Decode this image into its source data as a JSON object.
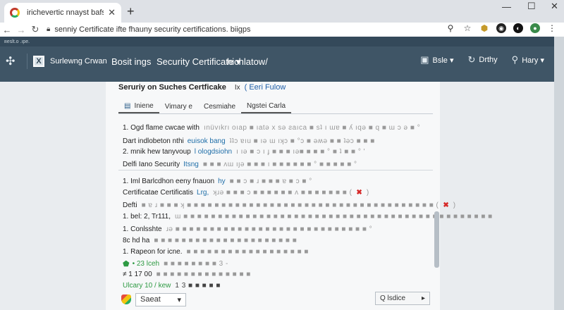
{
  "browser": {
    "tab_title": "irichevertic nnayst bafs",
    "url": "senniy Certificate ifte fhauny security certifications. biigps",
    "lock_icon": "lock-icon",
    "nav": {
      "back": "←",
      "forward": "→",
      "reload": "↻"
    },
    "window": {
      "min": "—",
      "max": "☐",
      "close": "✕"
    }
  },
  "app": {
    "top_strip": "ʀeslt.o .ıpe.",
    "brand_name": "Surlewng Crwan",
    "brand_box": "X",
    "nav": [
      "Bosit ings",
      "Security Certificate ▾",
      "hichlatow/"
    ],
    "header_buttons": [
      {
        "icon": "dashboard-icon",
        "glyph": "▣",
        "label": "Bsle ▾"
      },
      {
        "icon": "refresh-icon",
        "glyph": "↻",
        "label": "Drthy"
      },
      {
        "icon": "help-icon",
        "glyph": "⚲",
        "label": "Hary ▾"
      }
    ]
  },
  "page": {
    "title": "Seruriy on Suches Certficake",
    "title_x": "Ix",
    "title_link": "( Eeri Fulow",
    "tabs": [
      {
        "label": "Iniene",
        "icon": "document-icon"
      },
      {
        "label": "Vimary e"
      },
      {
        "label": "Cesmiahe"
      },
      {
        "label": "Ngstei Carla"
      }
    ],
    "rows": [
      {
        "text": "1.   Ogd flame cwcae with",
        "blur": "ınüvıkrı oıap ■ ıatǝ x sǝ ƨaıca ■ sʇ ı ɯɐ ■ ʎ ıqǝ ■ q ■ ɯ ɔ ǝ ■ °"
      },
      {
        "text": "Dart indlobeton nthi",
        "link": "euisok bang",
        "blur": "ʇʇɔ ɐıu ■ ıǝ ɯ ıʞɔ ■ °ɔ ■ ǝʍǝ ■ ■ ʇǝɔ ■ ■ ■"
      },
      {
        "text": "2.    mnik hew tanyvoup",
        "link": "l ologdsiohn",
        "blur": "ı ıǝ ■ ɔ ı ɟ ■ ■ ■ ıǝ■ ■ ■ ■ ° ■ ʇ ■ ■ ° '"
      },
      {
        "text": "Delfi Iano Security",
        "link": "Itsng",
        "blur": "■ ■ ■ ʌɯ ıȷǝ ■ ■ ■ ı ■ ■ ■ ■ ■ ■ ° ■ ■ ■ ■ ■ °"
      },
      {
        "text": "1.   Iml Barlcdhon eeny fnauon",
        "link": "hy",
        "blur": "■ ■ ɔ ■ ɹ ■ ■ ■ ɐ ■ ɔ ■ °"
      },
      {
        "text": "Certificatae Certificatis",
        "link": "Lrg,",
        "blur": "ʞɹǝ ■ ■ ■ ɔ ■ ■ ■ ■ ■ ■ ʌ ■ ■ ■ ■ ■ ■ ■ (",
        "red": "✖",
        "tail": ")"
      },
      {
        "text": "Defti",
        "blur": "■ ɐ ɹ ■ ■ ■ ʞ ■ ■ ■ ■ ■ ■ ■ ■ ■ ■ ■ ■ ■ ■ ■ ■ ■ ■ ■ ■ ■ ■ ■ ■ ■ ■ ■ ■ ■ ■ ■ ■ ■ ■ ■ ■ (",
        "red": "✖",
        "tail": ")"
      },
      {
        "text": "1.   bel: 2, Tr111,",
        "blur": "ɯ ■ ■ ■ ■ ■ ■ ■ ■ ■ ■ ■ ■ ■ ■ ■ ■ ■ ■ ■ ■ ■ ■ ■ ■ ■ ■ ■ ■ ■ ■ ■ ■ ■ ■ ■ ■ ■ ■ ■ ■ ■ ■ ■ ■ ■"
      },
      {
        "text": "1.   Conlsshte",
        "blur": "ɹǝ ■ ■ ■ ■ ■ ■ ■ ■ ■ ■ ■ ■ ■ ■ ■ ■ ■ ■ ■ ■ ■ ■ ■ ■ ■ ■ ■ ■ °"
      },
      {
        "text": "   8c    hd ha",
        "blur": "■ ■ ■ ■ ■ ■ ■ ■ ■ ■ ■ ■ ■ ■ ■ ■ ■ ■ ■ ■ ■"
      },
      {
        "text": "1.   Rapeon for icne.",
        "blur": "■ ■ ■ ■ ■ ■ ■ ■ ■ ■ ■ ■ ■ ■ ■ ■ ■ ■"
      },
      {
        "text": "",
        "green": "• 23 lceh",
        "blur": "■ ■ ■ ■ ■ ■ ■ ■ 3 -"
      },
      {
        "text": "   ≠ 1  17 00",
        "blur": "■ ■ ■ ■ ■ ■ ■ ■ ■ ■ ■ ■ ■ ■"
      },
      {
        "text": "Ulcary 10 / kew",
        "blur": "1        3    ■    ■    ■    ■    ■"
      }
    ]
  },
  "footer": {
    "select_value": "Saeat",
    "select_chevron": "▾",
    "search_label": "Q lsdice",
    "search_chevron": "▸"
  },
  "colors": {
    "header": "#3f5566",
    "link": "#1f6ea8",
    "red": "#d62828",
    "green": "#2e9a43"
  }
}
